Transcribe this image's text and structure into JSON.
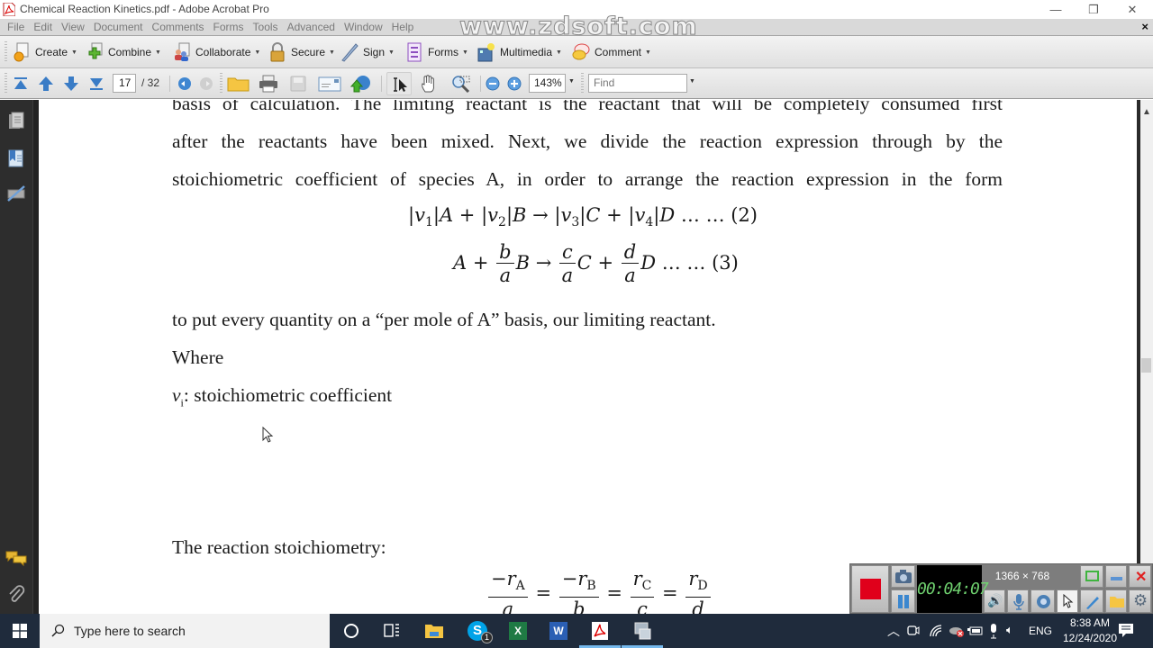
{
  "window": {
    "title": "Chemical Reaction Kinetics.pdf - Adobe Acrobat Pro",
    "controls": {
      "minimize": "—",
      "restore": "❐",
      "close": "✕"
    }
  },
  "watermark": "www.zdsoft.com",
  "menubar": {
    "items": [
      "File",
      "Edit",
      "View",
      "Document",
      "Comments",
      "Forms",
      "Tools",
      "Advanced",
      "Window",
      "Help"
    ],
    "doc_close": "×"
  },
  "tasks_toolbar": {
    "buttons": [
      {
        "label": "Create",
        "icon": "create-pdf-icon"
      },
      {
        "label": "Combine",
        "icon": "combine-files-icon"
      },
      {
        "label": "Collaborate",
        "icon": "collaborate-icon"
      },
      {
        "label": "Secure",
        "icon": "lock-icon"
      },
      {
        "label": "Sign",
        "icon": "pen-icon"
      },
      {
        "label": "Forms",
        "icon": "form-icon"
      },
      {
        "label": "Multimedia",
        "icon": "multimedia-icon"
      },
      {
        "label": "Comment",
        "icon": "comment-icon"
      }
    ],
    "caret": "▼"
  },
  "nav_toolbar": {
    "current_page": "17",
    "page_sep": "/ 32",
    "zoom": "143%",
    "find_placeholder": "Find",
    "caret": "▼"
  },
  "document": {
    "lines": [
      "basis of calculation. The limiting reactant is the reactant that will be completely consumed first",
      "after the reactants have been mixed. Next, we divide the reaction expression through by the",
      "stoichiometric coefficient of species A, in order to arrange the reaction expression in the form"
    ],
    "eq2_label": "… … (2)",
    "eq3_label": "… … (3)",
    "after_eq": "to put every quantity on a “per mole of A” basis, our limiting reactant.",
    "where": "Where",
    "vi_symbol": "v",
    "vi_sub": "i",
    "vi_def": ": stoichiometric coefficient",
    "stoich_heading": "The reaction stoichiometry:"
  },
  "recorder": {
    "timer": "00:04:07",
    "resolution": "1366 × 768"
  },
  "taskbar": {
    "search_placeholder": "Type here to search",
    "skype_badge": "1",
    "language": "ENG",
    "time": "8:38 AM",
    "date": "12/24/2020"
  }
}
